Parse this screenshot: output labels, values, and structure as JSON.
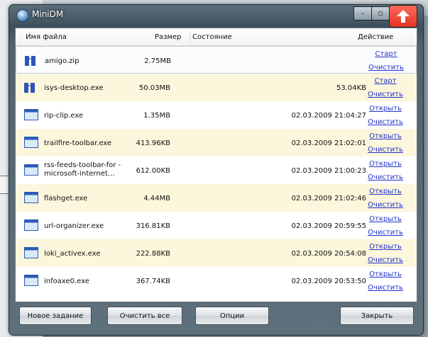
{
  "window": {
    "title": "MiniDM",
    "minimize_glyph": "–",
    "maximize_glyph": "▫",
    "close_glyph": "🡅"
  },
  "columns": {
    "name": "Имя файла",
    "size": "Размер",
    "status": "Состояние",
    "action": "Действие"
  },
  "files": [
    {
      "icon": "zip-archive-icon",
      "name": "amigo.zip",
      "size": "2.75MB",
      "status": "",
      "action1": "Старт",
      "action2": "Очистить"
    },
    {
      "icon": "zip-archive-icon",
      "name": "isys-desktop.exe",
      "size": "50.03MB",
      "status": "53.04KB",
      "action1": "Старт",
      "action2": "Очистить"
    },
    {
      "icon": "exe-window-icon",
      "name": "rip-clip.exe",
      "size": "1.35MB",
      "status": "02.03.2009 21:04:27",
      "action1": "Открыть",
      "action2": "Очистить"
    },
    {
      "icon": "exe-window-icon",
      "name": "trailfire-toolbar.exe",
      "size": "413.96KB",
      "status": "02.03.2009 21:02:01",
      "action1": "Открыть",
      "action2": "Очистить"
    },
    {
      "icon": "exe-window-icon",
      "name": "rss-feeds-toolbar-for -microsoft-internet…",
      "size": "612.00KB",
      "status": "02.03.2009 21:00:23",
      "action1": "Открыть",
      "action2": "Очистить"
    },
    {
      "icon": "exe-window-icon",
      "name": "flashget.exe",
      "size": "4.44MB",
      "status": "02.03.2009 21:02:46",
      "action1": "Открыть",
      "action2": "Очистить"
    },
    {
      "icon": "exe-window-icon",
      "name": "url-organizer.exe",
      "size": "316.81KB",
      "status": "02.03.2009 20:59:55",
      "action1": "Открыть",
      "action2": "Очистить"
    },
    {
      "icon": "exe-window-icon",
      "name": "loki_activex.exe",
      "size": "222.88KB",
      "status": "02.03.2009 20:54:08",
      "action1": "Открыть",
      "action2": "Очистить"
    },
    {
      "icon": "exe-window-icon",
      "name": "infoaxe0.exe",
      "size": "367.74KB",
      "status": "02.03.2009 20:53:50",
      "action1": "Открыть",
      "action2": "Очистить"
    }
  ],
  "buttons": {
    "new_task": "Новое задание",
    "clear_all": "Очистить все",
    "options": "Опции",
    "close": "Закрыть"
  },
  "colors": {
    "link": "#2232c8",
    "highlight_row": "#fbf6dc",
    "accent_red": "#e11f10"
  }
}
